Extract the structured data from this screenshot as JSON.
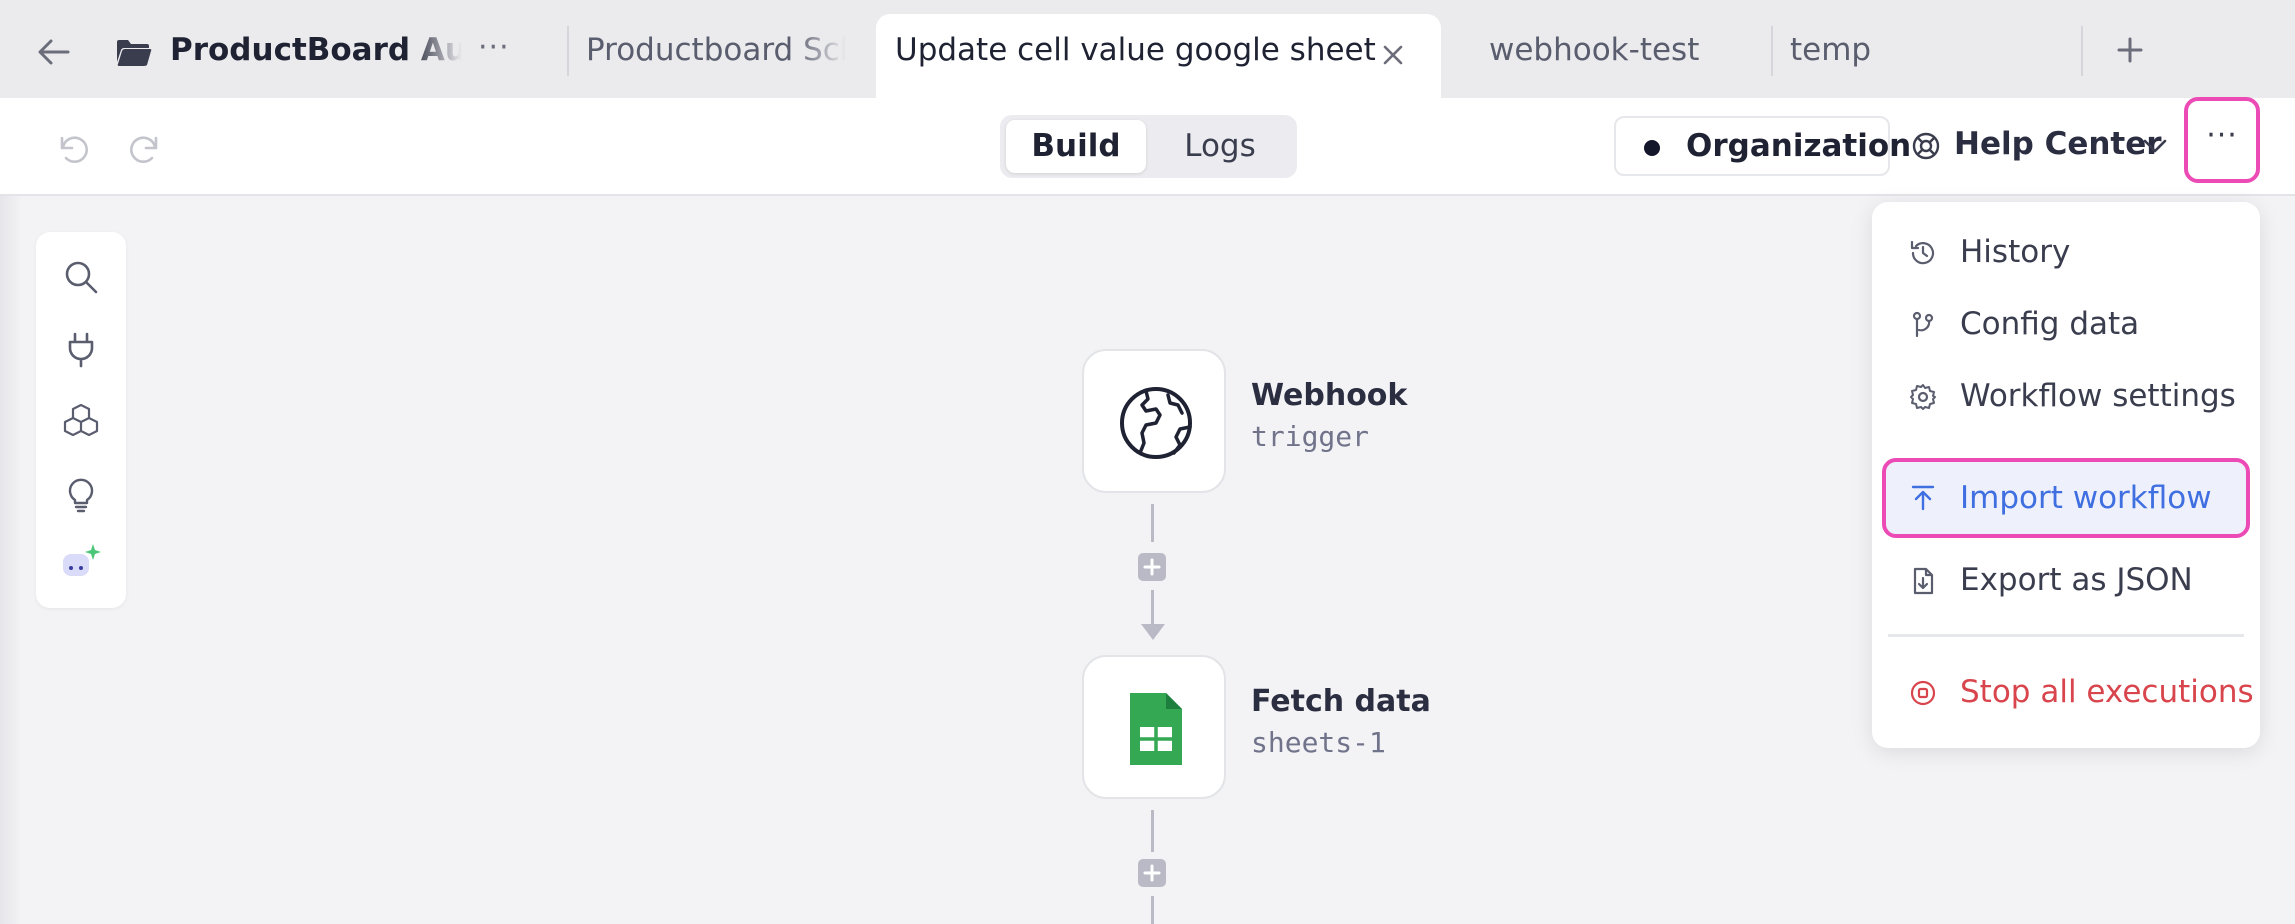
{
  "tabbar": {
    "project_title": "ProductBoard Automations",
    "project_more": "···",
    "tabs": [
      {
        "label": "Productboard Schedule"
      },
      {
        "label": "Update cell value google sheet"
      },
      {
        "label": "webhook-test"
      },
      {
        "label": "temp"
      }
    ],
    "plus_label": "+"
  },
  "toolbar": {
    "modes": {
      "build": "Build",
      "logs": "Logs"
    },
    "active_mode": "Build",
    "organization": "Organization",
    "help": "Help Center",
    "more": "···"
  },
  "canvas": {
    "nodes": [
      {
        "title": "Webhook",
        "subtitle": "trigger",
        "icon": "globe-icon"
      },
      {
        "title": "Fetch data",
        "subtitle": "sheets-1",
        "icon": "google-sheets-icon"
      }
    ]
  },
  "menu": {
    "items": [
      {
        "label": "History",
        "icon": "history-icon"
      },
      {
        "label": "Config data",
        "icon": "branch-icon"
      },
      {
        "label": "Workflow settings",
        "icon": "gear-icon"
      },
      {
        "label": "Import workflow",
        "icon": "upload-icon",
        "highlighted": true
      },
      {
        "label": "Export as JSON",
        "icon": "file-download-icon"
      },
      {
        "label": "Stop all executions",
        "icon": "stop-circle-icon",
        "danger": true
      }
    ]
  },
  "colors": {
    "accent_highlight": "#ec4bb5",
    "link_blue": "#3f6fe0",
    "danger_red": "#d8454c",
    "sheets_green": "#34a853"
  }
}
